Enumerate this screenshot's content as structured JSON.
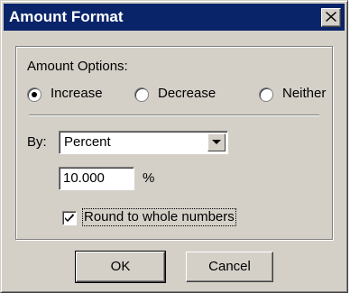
{
  "window": {
    "title": "Amount Format",
    "close_icon": "close-icon"
  },
  "amount_options": {
    "label": "Amount Options:",
    "selected": "Increase",
    "options": [
      {
        "label": "Increase",
        "checked": true
      },
      {
        "label": "Decrease",
        "checked": false
      },
      {
        "label": "Neither",
        "checked": false
      }
    ]
  },
  "by": {
    "label": "By:",
    "selected_value": "Percent",
    "dropdown_icon": "chevron-down-icon"
  },
  "amount": {
    "value": "10.000",
    "unit": "%"
  },
  "round": {
    "label": "Round to whole numbers",
    "checked": true
  },
  "buttons": {
    "ok_label": "OK",
    "cancel_label": "Cancel"
  }
}
